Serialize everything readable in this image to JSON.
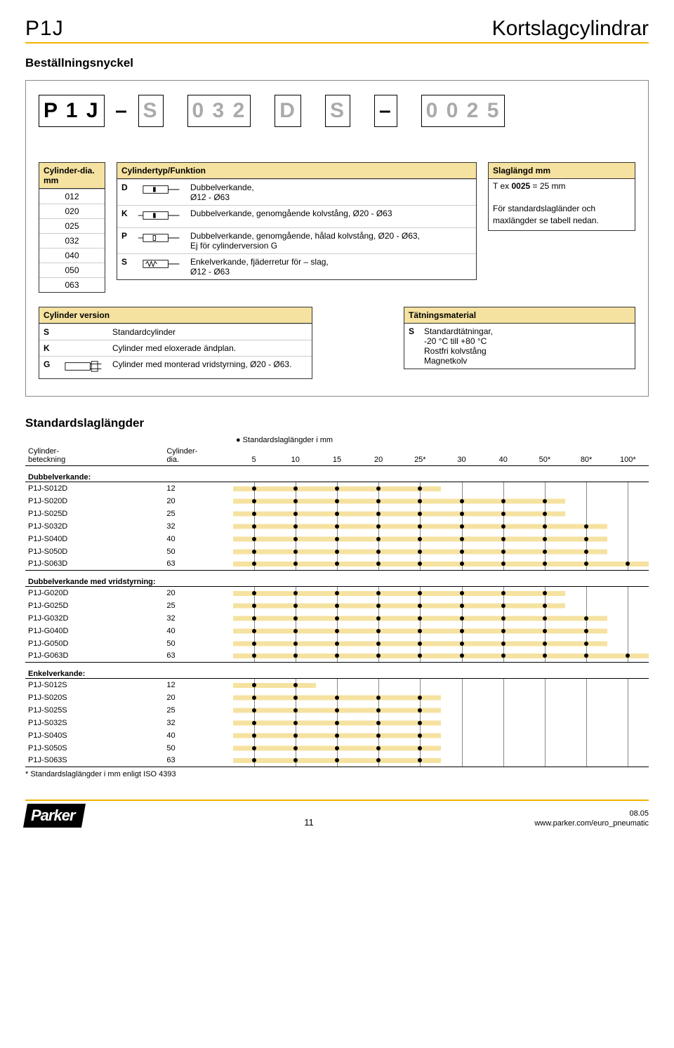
{
  "header": {
    "left": "P1J",
    "right": "Kortslagcylindrar"
  },
  "section_title": "Beställningsnyckel",
  "order_code": {
    "cells": [
      {
        "text": "P 1 J",
        "gray": false,
        "type": "box"
      },
      {
        "text": "–",
        "gray": false,
        "type": "dash"
      },
      {
        "text": "S",
        "gray": true,
        "type": "box"
      },
      {
        "text": "0 3 2",
        "gray": true,
        "type": "box"
      },
      {
        "text": "D",
        "gray": true,
        "type": "box"
      },
      {
        "text": "S",
        "gray": true,
        "type": "box"
      },
      {
        "text": "–",
        "gray": false,
        "type": "box"
      },
      {
        "text": "0 0 2 5",
        "gray": true,
        "type": "box"
      }
    ]
  },
  "cyl_dia": {
    "title": "Cylinder-dia. mm",
    "values": [
      "012",
      "020",
      "025",
      "032",
      "040",
      "050",
      "063"
    ]
  },
  "cyl_func": {
    "title": "Cylindertyp/Funktion",
    "rows": [
      {
        "code": "D",
        "desc": "Dubbelverkande,\nØ12 - Ø63"
      },
      {
        "code": "K",
        "desc": "Dubbelverkande, genomgående kolvstång, Ø20 - Ø63"
      },
      {
        "code": "P",
        "desc": "Dubbelverkande, genomgående, hålad kolvstång, Ø20 - Ø63,\nEj för cylinderversion G"
      },
      {
        "code": "S",
        "desc": "Enkelverkande, fjäderretur för – slag,\nØ12 - Ø63"
      }
    ]
  },
  "stroke_box": {
    "title": "Slaglängd mm",
    "line1_pre": "T ex ",
    "line1_bold": "0025",
    "line1_post": " = 25 mm",
    "line2": "För standardslagländer och maxlängder se tabell nedan."
  },
  "cyl_version": {
    "title": "Cylinder version",
    "rows": [
      {
        "code": "S",
        "desc": "Standardcylinder",
        "icon": false
      },
      {
        "code": "K",
        "desc": "Cylinder med eloxerade ändplan.",
        "icon": false
      },
      {
        "code": "G",
        "desc": "Cylinder med monterad vridstyrning, Ø20 - Ø63.",
        "icon": true
      }
    ]
  },
  "seal": {
    "title": "Tätningsmaterial",
    "rows": [
      {
        "code": "S",
        "desc": "Standardtätningar,\n-20 °C till +80 °C\nRostfri kolvstång\nMagnetkolv"
      }
    ]
  },
  "std_strokes": {
    "title": "Standardslaglängder",
    "col_label": "Cylinder-\nbeteckning",
    "col_dia": "Cylinder-\ndia.",
    "col_strokes_pre": "●  Standardslaglängder i mm",
    "stroke_headers": [
      "5",
      "10",
      "15",
      "20",
      "25*",
      "30",
      "40",
      "50*",
      "80*",
      "100*"
    ],
    "groups": [
      {
        "name": "Dubbelverkande:",
        "rows": [
          {
            "label": "P1J-S012D",
            "dia": "12",
            "marks": [
              1,
              1,
              1,
              1,
              1,
              0,
              0,
              0,
              0,
              0
            ]
          },
          {
            "label": "P1J-S020D",
            "dia": "20",
            "marks": [
              1,
              1,
              1,
              1,
              1,
              1,
              1,
              1,
              0,
              0
            ]
          },
          {
            "label": "P1J-S025D",
            "dia": "25",
            "marks": [
              1,
              1,
              1,
              1,
              1,
              1,
              1,
              1,
              0,
              0
            ]
          },
          {
            "label": "P1J-S032D",
            "dia": "32",
            "marks": [
              1,
              1,
              1,
              1,
              1,
              1,
              1,
              1,
              1,
              0
            ]
          },
          {
            "label": "P1J-S040D",
            "dia": "40",
            "marks": [
              1,
              1,
              1,
              1,
              1,
              1,
              1,
              1,
              1,
              0
            ]
          },
          {
            "label": "P1J-S050D",
            "dia": "50",
            "marks": [
              1,
              1,
              1,
              1,
              1,
              1,
              1,
              1,
              1,
              0
            ]
          },
          {
            "label": "P1J-S063D",
            "dia": "63",
            "marks": [
              1,
              1,
              1,
              1,
              1,
              1,
              1,
              1,
              1,
              1
            ]
          }
        ]
      },
      {
        "name": "Dubbelverkande med vridstyrning:",
        "rows": [
          {
            "label": "P1J-G020D",
            "dia": "20",
            "marks": [
              1,
              1,
              1,
              1,
              1,
              1,
              1,
              1,
              0,
              0
            ]
          },
          {
            "label": "P1J-G025D",
            "dia": "25",
            "marks": [
              1,
              1,
              1,
              1,
              1,
              1,
              1,
              1,
              0,
              0
            ]
          },
          {
            "label": "P1J-G032D",
            "dia": "32",
            "marks": [
              1,
              1,
              1,
              1,
              1,
              1,
              1,
              1,
              1,
              0
            ]
          },
          {
            "label": "P1J-G040D",
            "dia": "40",
            "marks": [
              1,
              1,
              1,
              1,
              1,
              1,
              1,
              1,
              1,
              0
            ]
          },
          {
            "label": "P1J-G050D",
            "dia": "50",
            "marks": [
              1,
              1,
              1,
              1,
              1,
              1,
              1,
              1,
              1,
              0
            ]
          },
          {
            "label": "P1J-G063D",
            "dia": "63",
            "marks": [
              1,
              1,
              1,
              1,
              1,
              1,
              1,
              1,
              1,
              1
            ]
          }
        ]
      },
      {
        "name": "Enkelverkande:",
        "rows": [
          {
            "label": "P1J-S012S",
            "dia": "12",
            "marks": [
              1,
              1,
              0,
              0,
              0,
              0,
              0,
              0,
              0,
              0
            ]
          },
          {
            "label": "P1J-S020S",
            "dia": "20",
            "marks": [
              1,
              1,
              1,
              1,
              1,
              0,
              0,
              0,
              0,
              0
            ]
          },
          {
            "label": "P1J-S025S",
            "dia": "25",
            "marks": [
              1,
              1,
              1,
              1,
              1,
              0,
              0,
              0,
              0,
              0
            ]
          },
          {
            "label": "P1J-S032S",
            "dia": "32",
            "marks": [
              1,
              1,
              1,
              1,
              1,
              0,
              0,
              0,
              0,
              0
            ]
          },
          {
            "label": "P1J-S040S",
            "dia": "40",
            "marks": [
              1,
              1,
              1,
              1,
              1,
              0,
              0,
              0,
              0,
              0
            ]
          },
          {
            "label": "P1J-S050S",
            "dia": "50",
            "marks": [
              1,
              1,
              1,
              1,
              1,
              0,
              0,
              0,
              0,
              0
            ]
          },
          {
            "label": "P1J-S063S",
            "dia": "63",
            "marks": [
              1,
              1,
              1,
              1,
              1,
              0,
              0,
              0,
              0,
              0
            ]
          }
        ]
      }
    ],
    "footnote": "* Standardslaglängder i mm enligt ISO 4393"
  },
  "footer": {
    "logo": "Parker",
    "page": "11",
    "date": "08.05",
    "url": "www.parker.com/euro_pneumatic"
  }
}
